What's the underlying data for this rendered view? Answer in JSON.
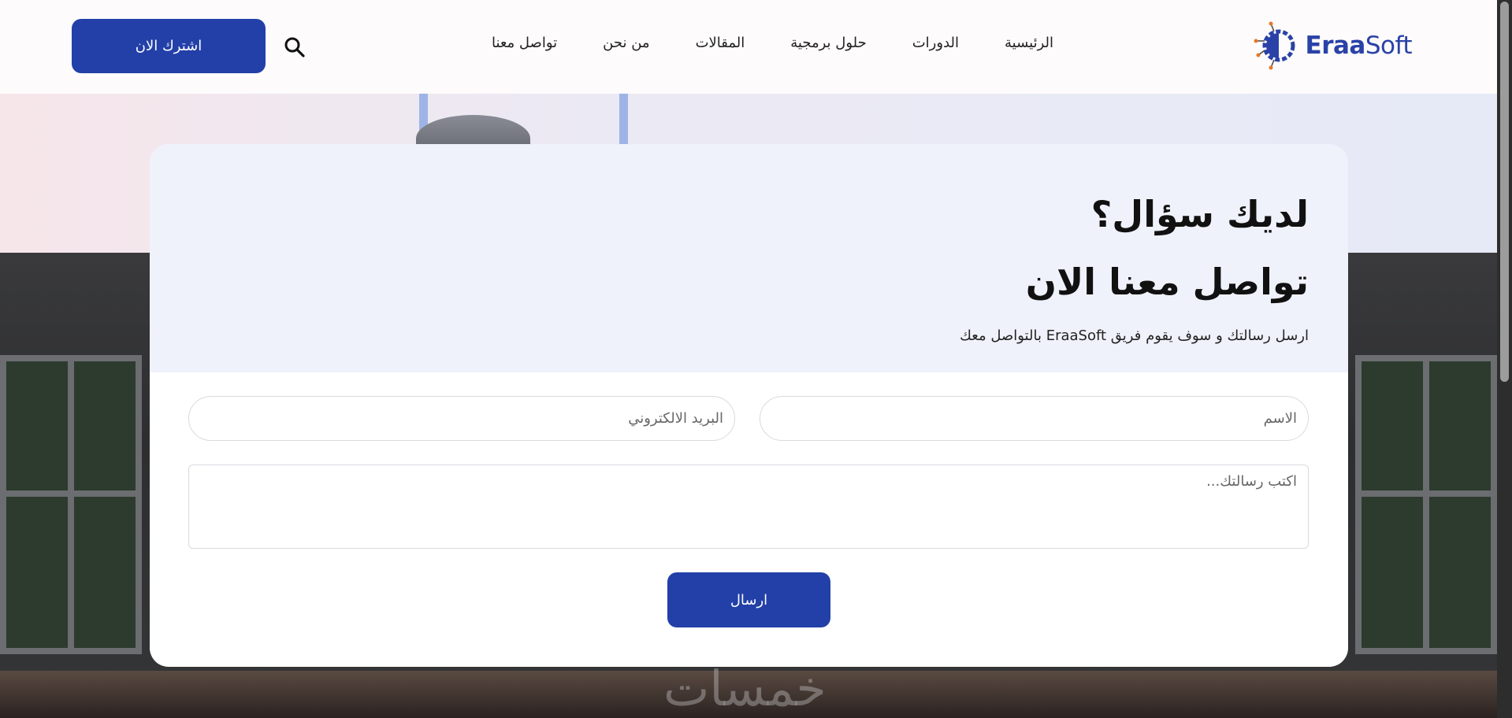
{
  "header": {
    "logo": {
      "part1": "Eraa",
      "part2": "Soft"
    },
    "nav": [
      "الرئيسية",
      "الدورات",
      "حلول برمجية",
      "المقالات",
      "من نحن",
      "تواصل معنا"
    ],
    "subscribe_label": "اشترك الان"
  },
  "contact": {
    "title1": "لديك سؤال؟",
    "title2": "تواصل معنا الان",
    "subtitle": "ارسل رسالتك و سوف يقوم فريق EraaSoft بالتواصل معك",
    "name_placeholder": "الاسم",
    "email_placeholder": "البريد الالكتروني",
    "message_placeholder": "اكتب رسالتك...",
    "send_label": "ارسال"
  },
  "watermark": "خمسات",
  "colors": {
    "brand": "#2240a8",
    "card_top": "#eff2fb"
  }
}
